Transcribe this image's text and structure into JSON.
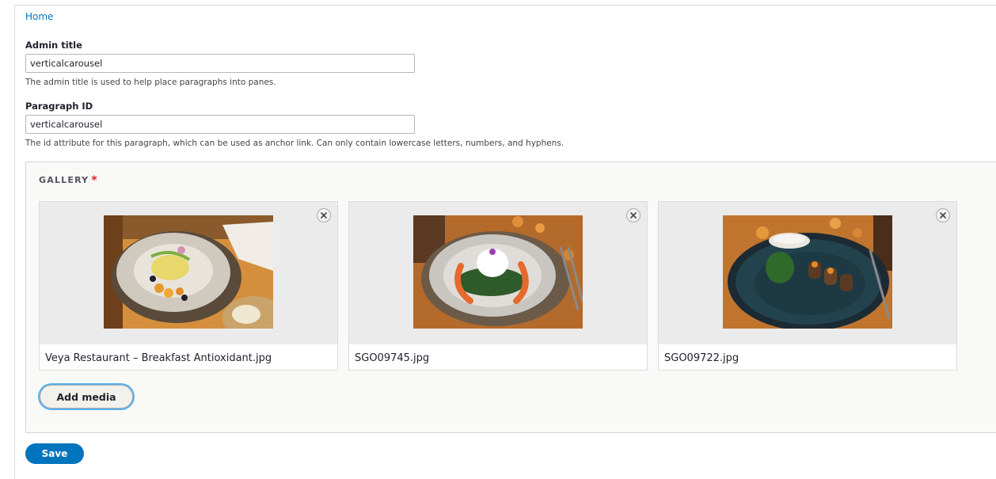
{
  "breadcrumb": {
    "home": "Home"
  },
  "admin_title": {
    "label": "Admin title",
    "value": "verticalcarousel",
    "description": "The admin title is used to help place paragraphs into panes."
  },
  "paragraph_id": {
    "label": "Paragraph ID",
    "value": "verticalcarousel",
    "description": "The id attribute for this paragraph, which can be used as anchor link. Can only contain lowercase letters, numbers, and hyphens."
  },
  "gallery": {
    "title": "GALLERY",
    "required_marker": "*",
    "items": [
      {
        "filename": "Veya Restaurant – Breakfast Antioxidant.jpg"
      },
      {
        "filename": "SGO09745.jpg"
      },
      {
        "filename": "SGO09722.jpg"
      }
    ],
    "add_media_label": "Add media"
  },
  "actions": {
    "save_label": "Save"
  },
  "colors": {
    "link": "#0074bd",
    "primary_button": "#0074bd",
    "required": "#dc2323",
    "focus_ring": "#58b3ee"
  }
}
